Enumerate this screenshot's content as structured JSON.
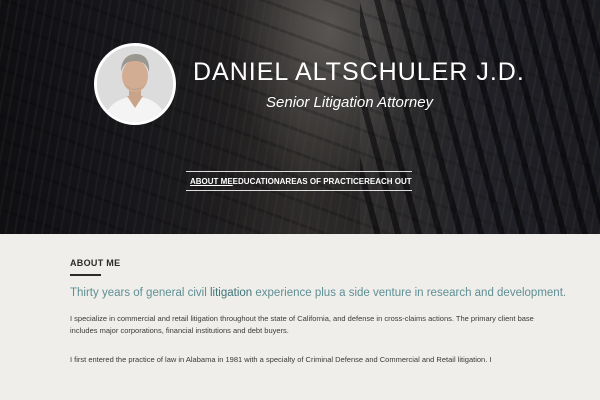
{
  "header": {
    "name": "DANIEL ALTSCHULER J.D.",
    "subtitle": "Senior Litigation Attorney"
  },
  "nav": {
    "items": [
      {
        "label": "ABOUT ME",
        "active": true
      },
      {
        "label": "EDUCATION",
        "active": false
      },
      {
        "label": "AREAS OF PRACTICE",
        "active": false
      },
      {
        "label": "REACH OUT",
        "active": false
      }
    ]
  },
  "about": {
    "title": "ABOUT ME",
    "lead_before": "Thirty years of general civil",
    "lead_highlight": "litigation",
    "lead_after": "experience plus a side venture in research and development.",
    "paragraph1": "I specialize in commercial and retail litigation throughout the state of California, and defense in cross-claims actions. The primary client base includes major corporations, financial institutions and debt buyers.",
    "paragraph2": "I first entered the practice of law in Alabama in 1981 with a specialty of Criminal Defense and Commercial and Retail litigation. I"
  },
  "colors": {
    "accent": "#5e8f94",
    "accent_highlight": "#3f7479",
    "page_background": "#efeeea",
    "text": "#3a3a3a"
  }
}
